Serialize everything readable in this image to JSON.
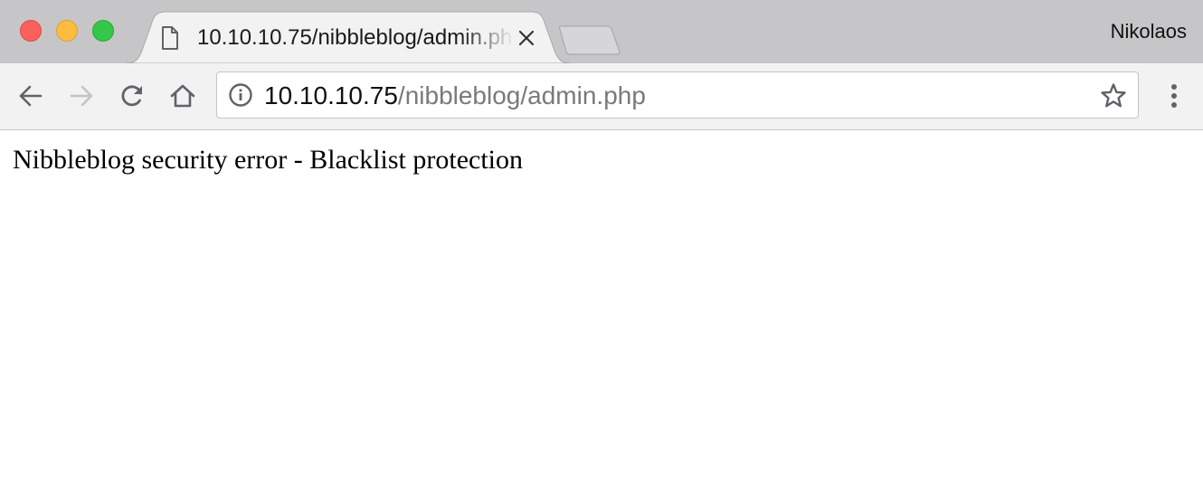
{
  "window": {
    "controls": [
      "close",
      "minimize",
      "maximize"
    ],
    "profile_name": "Nikolaos"
  },
  "tab": {
    "title": "10.10.10.75/nibbleblog/admin.php",
    "icon": "page-icon",
    "close_icon": "close-icon"
  },
  "toolbar": {
    "icons": [
      "back-arrow-icon",
      "forward-arrow-icon",
      "reload-icon",
      "home-icon",
      "info-icon",
      "star-icon",
      "menu-icon"
    ]
  },
  "address_bar": {
    "host": "10.10.10.75",
    "path": "/nibbleblog/admin.php"
  },
  "page": {
    "message": "Nibbleblog security error - Blacklist protection"
  },
  "colors": {
    "titlebar": "#c6c6c8",
    "tab_active": "#f2f2f2",
    "traffic_close": "#fc605c",
    "traffic_minimize": "#fdbc40",
    "traffic_maximize": "#34c749"
  }
}
